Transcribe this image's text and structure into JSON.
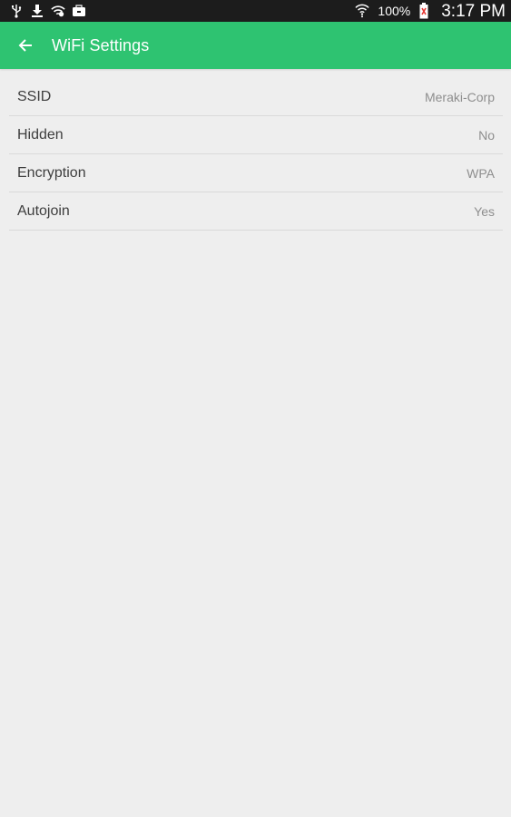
{
  "status_bar": {
    "icons_left": [
      "usb-icon",
      "download-icon",
      "wifi-icon",
      "briefcase-icon"
    ],
    "icons_right": [
      "wifi-signal-icon",
      "battery-icon"
    ],
    "battery_percent": "100%",
    "time": "3:17 PM"
  },
  "app_bar": {
    "back_icon": "arrow-left-icon",
    "title": "WiFi Settings",
    "color": "#2ec371"
  },
  "settings": [
    {
      "label": "SSID",
      "value": "Meraki-Corp"
    },
    {
      "label": "Hidden",
      "value": "No"
    },
    {
      "label": "Encryption",
      "value": "WPA"
    },
    {
      "label": "Autojoin",
      "value": "Yes"
    }
  ]
}
